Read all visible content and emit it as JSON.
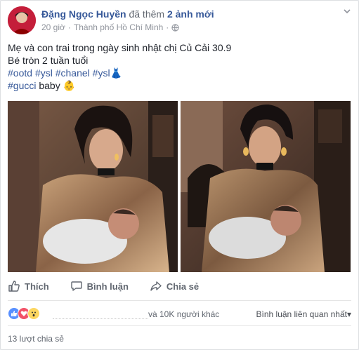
{
  "post": {
    "author": "Đặng Ngọc Huyền",
    "action_text": "đã thêm",
    "action_link": "2 ảnh mới",
    "time": "20 giờ",
    "dot": "·",
    "location": "Thành phố Hồ Chí Minh",
    "location_dot": "·",
    "menu_icon": "chevron-down-icon",
    "text_line1": "Mẹ và con trai trong ngày sinh nhật chị Củ Cải 30.9",
    "text_line2": "Bé tròn 2 tuần tuổi",
    "tag_ootd": "#ootd",
    "tag_ysl": "#ysl",
    "tag_chanel": "#chanel",
    "tag_ysl2": "#ysl",
    "dress_emoji": "👗",
    "tag_gucci": "#gucci",
    "baby_text": "baby",
    "baby_emoji": "👶"
  },
  "actions": {
    "like": "Thích",
    "comment": "Bình luận",
    "share": "Chia sẻ"
  },
  "reactions": {
    "others_text": "và 10K người khác",
    "sort_label": "Bình luận liên quan nhất",
    "sort_arrow": "▾",
    "share_count": "13 lượt chia sẻ"
  },
  "colors": {
    "link": "#365899",
    "like_blue": "#5890ff",
    "love_red": "#f25268",
    "wow_yellow": "#fcd660"
  }
}
